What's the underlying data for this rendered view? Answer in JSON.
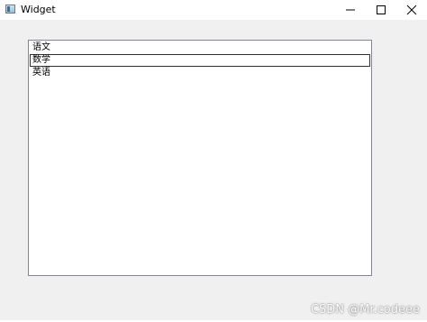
{
  "window": {
    "title": "Widget",
    "icon": "qt-window-icon",
    "controls": {
      "minimize": "minimize-icon",
      "maximize": "maximize-icon",
      "close": "close-icon"
    }
  },
  "list": {
    "items": [
      {
        "label": "语文"
      },
      {
        "label": "数学"
      },
      {
        "label": "英语"
      }
    ],
    "current_index": 1
  },
  "watermark": "CSDN @Mr.codeee",
  "colors": {
    "client_background": "#f0f0f0",
    "titlebar_background": "#ffffff",
    "list_border": "#828790",
    "focus_border": "#333333"
  }
}
